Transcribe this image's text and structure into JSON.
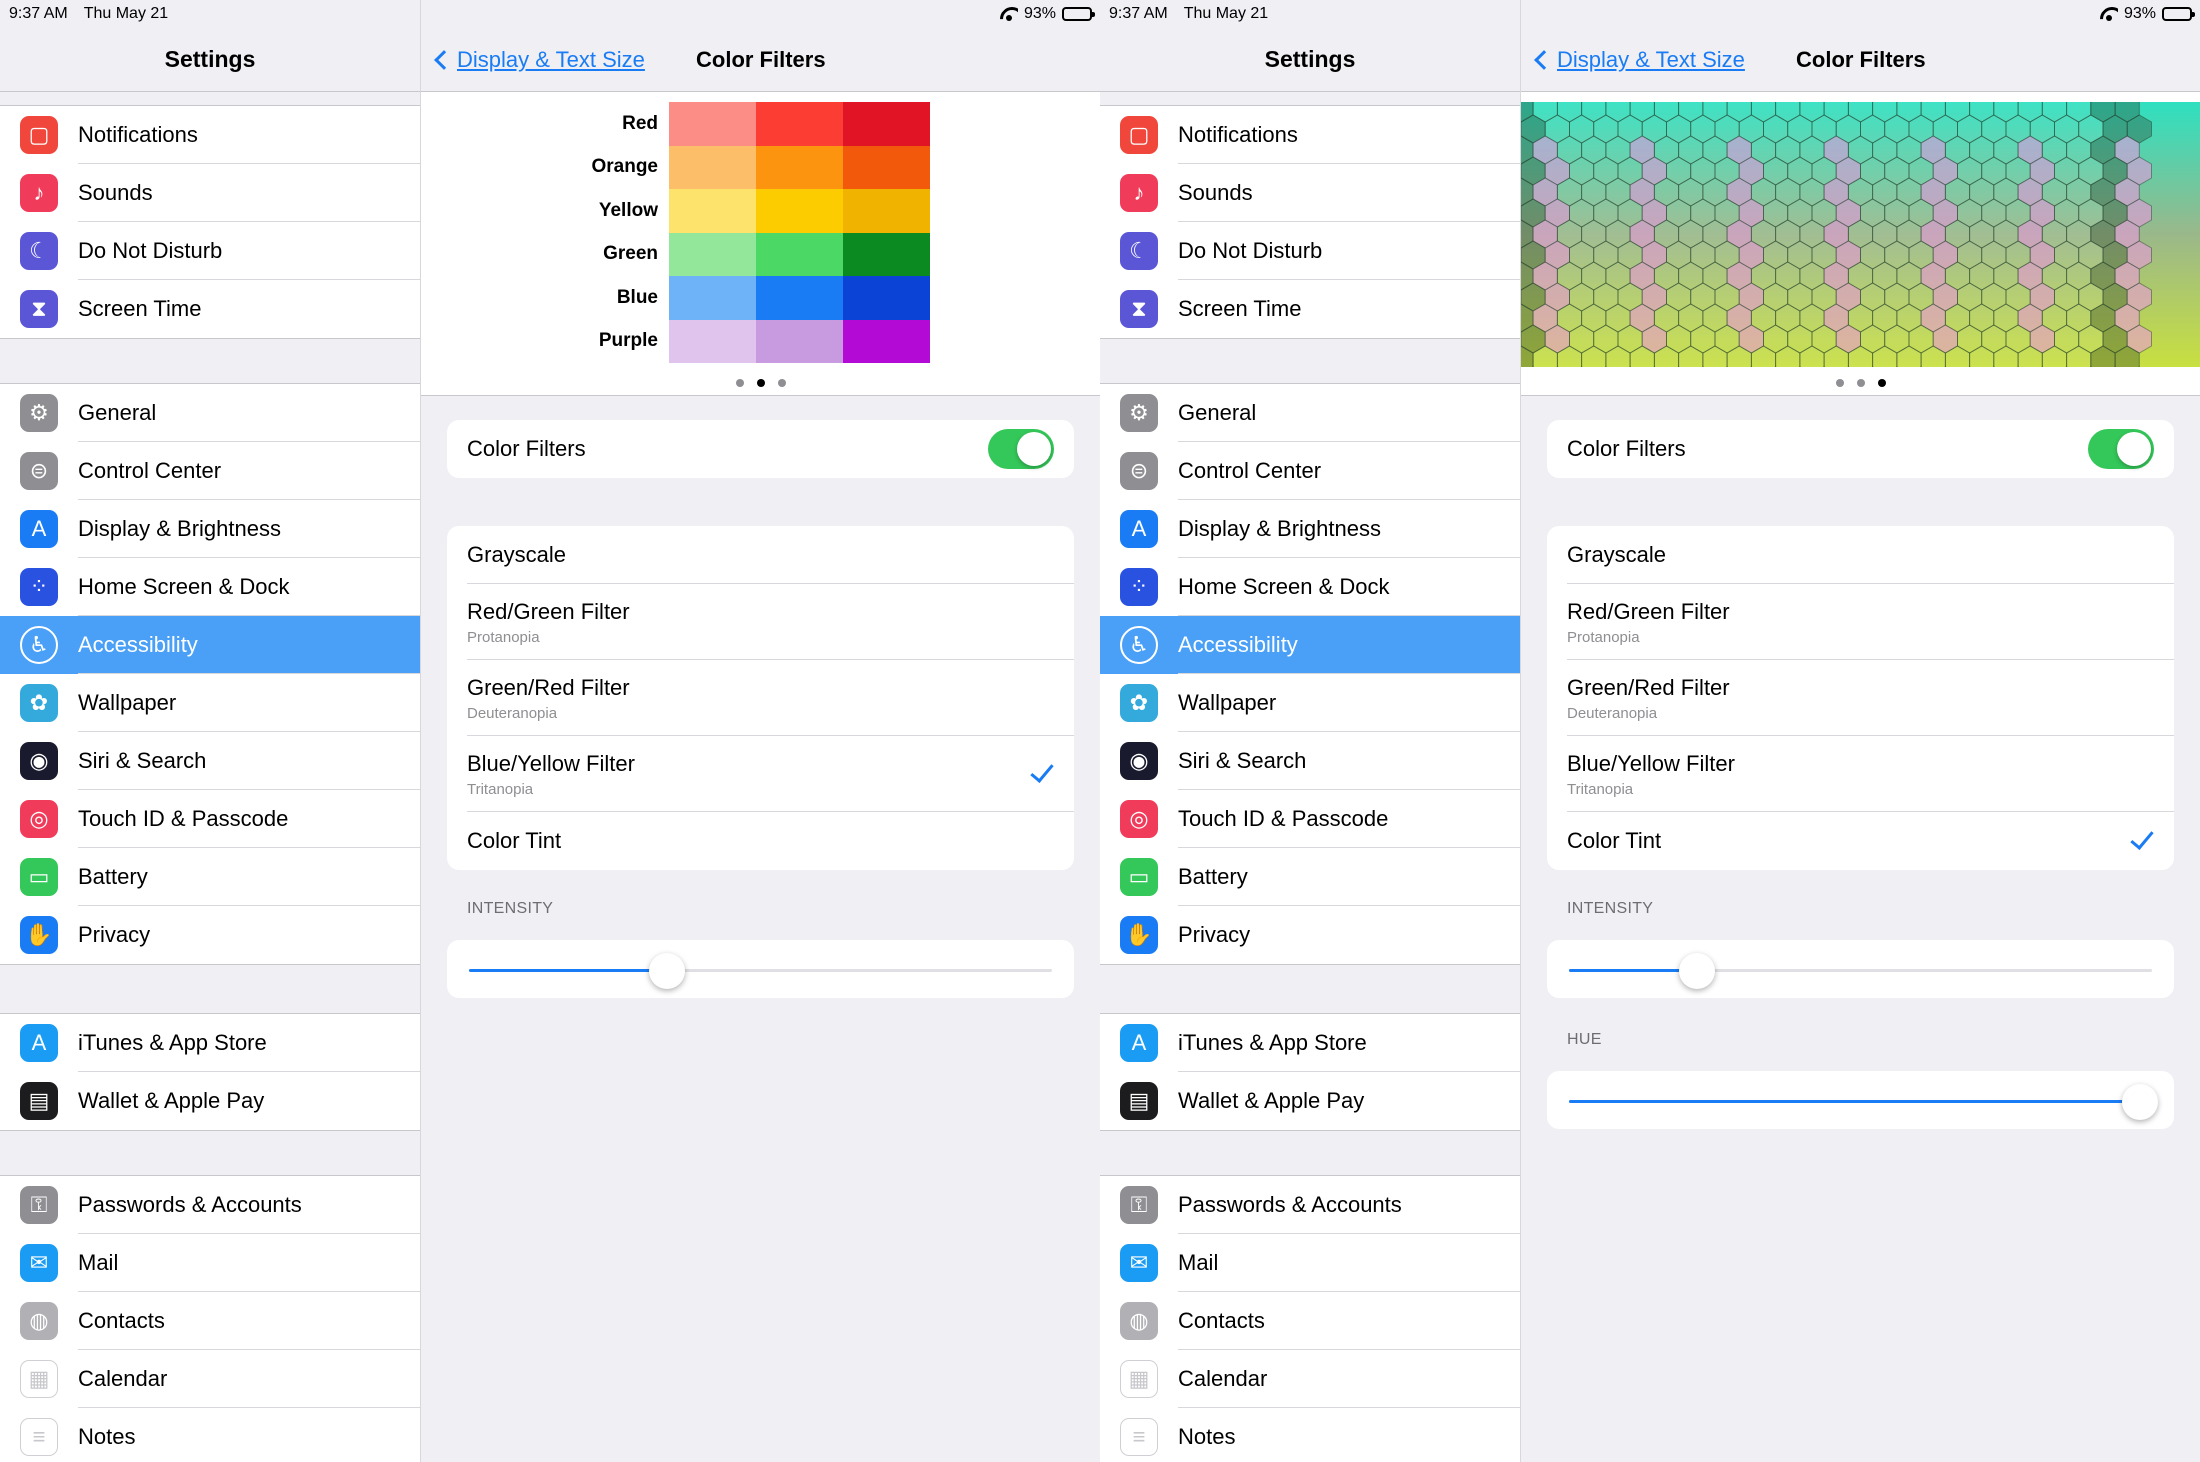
{
  "status": {
    "time": "9:37 AM",
    "date": "Thu May 21",
    "battery": "93%"
  },
  "sidebar": {
    "title": "Settings",
    "groups": [
      [
        {
          "label": "Notifications",
          "icon": "notifications-icon",
          "color": "#f0463c"
        },
        {
          "label": "Sounds",
          "icon": "sounds-icon",
          "color": "#f03c5a"
        },
        {
          "label": "Do Not Disturb",
          "icon": "moon-icon",
          "color": "#5a56d6"
        },
        {
          "label": "Screen Time",
          "icon": "hourglass-icon",
          "color": "#5a56d6"
        }
      ],
      [
        {
          "label": "General",
          "icon": "gear-icon",
          "color": "#8e8e93"
        },
        {
          "label": "Control Center",
          "icon": "switches-icon",
          "color": "#8e8e93"
        },
        {
          "label": "Display & Brightness",
          "icon": "display-icon",
          "color": "#1a7cf4"
        },
        {
          "label": "Home Screen & Dock",
          "icon": "grid-icon",
          "color": "#2a52e0"
        },
        {
          "label": "Accessibility",
          "icon": "accessibility-icon",
          "color": "#1a7cf4"
        },
        {
          "label": "Wallpaper",
          "icon": "flower-icon",
          "color": "#34aadc"
        },
        {
          "label": "Siri & Search",
          "icon": "siri-icon",
          "color": "#1a1a2e"
        },
        {
          "label": "Touch ID & Passcode",
          "icon": "fingerprint-icon",
          "color": "#f03c5a"
        },
        {
          "label": "Battery",
          "icon": "battery-icon",
          "color": "#34c759"
        },
        {
          "label": "Privacy",
          "icon": "hand-icon",
          "color": "#1a7cf4"
        }
      ],
      [
        {
          "label": "iTunes & App Store",
          "icon": "app-store-icon",
          "color": "#1a9cf4"
        },
        {
          "label": "Wallet & Apple Pay",
          "icon": "wallet-icon",
          "color": "#1c1c1e"
        }
      ],
      [
        {
          "label": "Passwords & Accounts",
          "icon": "key-icon",
          "color": "#8e8e93"
        },
        {
          "label": "Mail",
          "icon": "mail-icon",
          "color": "#1a9cf4"
        },
        {
          "label": "Contacts",
          "icon": "contacts-icon",
          "color": "#b0b0b5"
        },
        {
          "label": "Calendar",
          "icon": "calendar-icon",
          "color": "#ffffff"
        },
        {
          "label": "Notes",
          "icon": "notes-icon",
          "color": "#ffffff"
        }
      ]
    ]
  },
  "detail": {
    "back": "Display & Text Size",
    "title": "Color Filters",
    "color_labels": [
      "Red",
      "Orange",
      "Yellow",
      "Green",
      "Blue",
      "Purple"
    ],
    "swatches": [
      [
        "#fc8c86",
        "#fc3d33",
        "#e01425"
      ],
      [
        "#fdbe6a",
        "#fd9410",
        "#f2590a"
      ],
      [
        "#fde36c",
        "#fdcc00",
        "#f0b400"
      ],
      [
        "#92e79a",
        "#4cd864",
        "#0a8a20"
      ],
      [
        "#6eb3f8",
        "#1a7cf4",
        "#0a43d6"
      ],
      [
        "#e0c4ee",
        "#c89ae0",
        "#b40ad6"
      ]
    ],
    "color_filters_label": "Color Filters",
    "filters": [
      {
        "label": "Grayscale",
        "sub": ""
      },
      {
        "label": "Red/Green Filter",
        "sub": "Protanopia"
      },
      {
        "label": "Green/Red Filter",
        "sub": "Deuteranopia"
      },
      {
        "label": "Blue/Yellow Filter",
        "sub": "Tritanopia"
      },
      {
        "label": "Color Tint",
        "sub": ""
      }
    ],
    "intensity_label": "INTENSITY",
    "hue_label": "HUE"
  },
  "left_panel": {
    "selected_filter": 3,
    "page_dot": 1,
    "intensity": 0.34
  },
  "right_panel": {
    "selected_filter": 4,
    "page_dot": 2,
    "intensity": 0.22,
    "hue": 0.98
  },
  "colors": {
    "accent": "#1a7cf4",
    "selected_row": "#4aa0f7",
    "toggle_on": "#34c759"
  }
}
